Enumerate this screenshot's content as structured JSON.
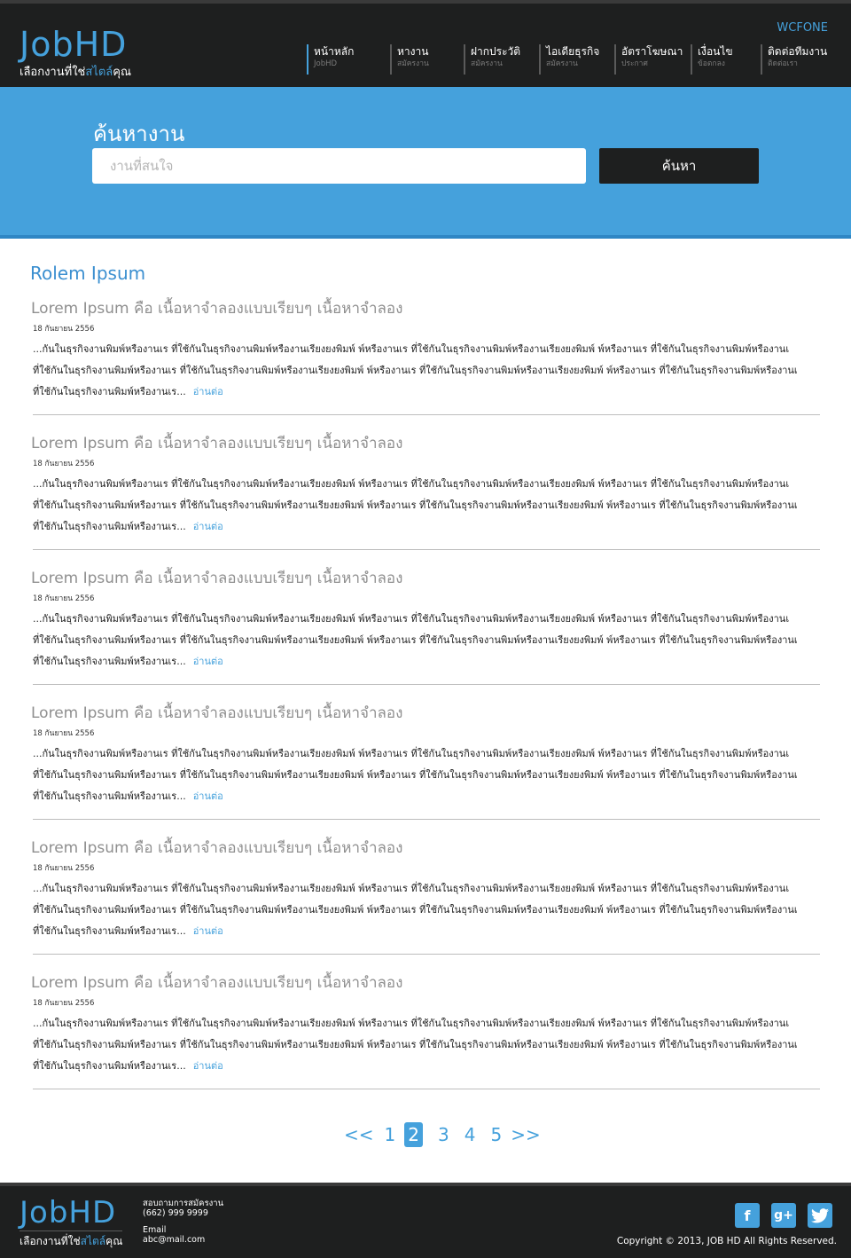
{
  "header": {
    "logo": "JobHD",
    "tagline_start": "เลือกงานที่ใช่",
    "tagline_highlight": "สไตล์",
    "tagline_end": "คุณ",
    "topright": "WCFONE"
  },
  "nav": [
    {
      "label": "หน้าหลัก",
      "sub": "JobHD"
    },
    {
      "label": "หางาน",
      "sub": "สมัครงาน"
    },
    {
      "label": "ฝากประวัติ",
      "sub": "สมัครงาน"
    },
    {
      "label": "ไอเดียธุรกิจ",
      "sub": "สมัครงาน"
    },
    {
      "label": "อัตราโฆษณา",
      "sub": "ประกาศ"
    },
    {
      "label": "เงื่อนไข",
      "sub": "ข้อตกลง"
    },
    {
      "label": "ติดต่อทีมงาน",
      "sub": "ติดต่อเรา"
    }
  ],
  "search": {
    "title": "ค้นหางาน",
    "placeholder": "งานที่สนใจ",
    "button": "ค้นหา"
  },
  "section": {
    "title": "Rolem Ipsum"
  },
  "articles": [
    {
      "title": "Lorem Ipsum คือ เนื้อหาจำลองแบบเรียบๆ เนื้อหาจำลอง",
      "date": "18 กันยายน 2556",
      "lines": [
        "...กันในธุรกิจงานพิมพ์หรืองานเร ที่ใช้กันในธุรกิจงานพิมพ์หรืองานเรียงยงพิมพ์ พ์หรืองานเร ที่ใช้กันในธุรกิจงานพิมพ์หรืองานเรียงยงพิมพ์ พ์หรืองานเร ที่ใช้กันในธุรกิจงานพิมพ์หรืองานเ",
        "ที่ใช้กันในธุรกิจงานพิมพ์หรืองานเร ที่ใช้กันในธุรกิจงานพิมพ์หรืองานเรียงยงพิมพ์ พ์หรืองานเร ที่ใช้กันในธุรกิจงานพิมพ์หรืองานเรียงยงพิมพ์ พ์หรืองานเร ที่ใช้กันในธุรกิจงานพิมพ์หรืองานเ",
        "ที่ใช้กันในธุรกิจงานพิมพ์หรืองานเร..."
      ],
      "readmore": "อ่านต่อ"
    },
    {
      "title": "Lorem Ipsum คือ เนื้อหาจำลองแบบเรียบๆ เนื้อหาจำลอง",
      "date": "18 กันยายน 2556",
      "lines": [
        "...กันในธุรกิจงานพิมพ์หรืองานเร ที่ใช้กันในธุรกิจงานพิมพ์หรืองานเรียงยงพิมพ์ พ์หรืองานเร ที่ใช้กันในธุรกิจงานพิมพ์หรืองานเรียงยงพิมพ์ พ์หรืองานเร ที่ใช้กันในธุรกิจงานพิมพ์หรืองานเ",
        "ที่ใช้กันในธุรกิจงานพิมพ์หรืองานเร ที่ใช้กันในธุรกิจงานพิมพ์หรืองานเรียงยงพิมพ์ พ์หรืองานเร ที่ใช้กันในธุรกิจงานพิมพ์หรืองานเรียงยงพิมพ์ พ์หรืองานเร ที่ใช้กันในธุรกิจงานพิมพ์หรืองานเ",
        "ที่ใช้กันในธุรกิจงานพิมพ์หรืองานเร..."
      ],
      "readmore": "อ่านต่อ"
    },
    {
      "title": "Lorem Ipsum คือ เนื้อหาจำลองแบบเรียบๆ เนื้อหาจำลอง",
      "date": "18 กันยายน 2556",
      "lines": [
        "...กันในธุรกิจงานพิมพ์หรืองานเร ที่ใช้กันในธุรกิจงานพิมพ์หรืองานเรียงยงพิมพ์ พ์หรืองานเร ที่ใช้กันในธุรกิจงานพิมพ์หรืองานเรียงยงพิมพ์ พ์หรืองานเร ที่ใช้กันในธุรกิจงานพิมพ์หรืองานเ",
        "ที่ใช้กันในธุรกิจงานพิมพ์หรืองานเร ที่ใช้กันในธุรกิจงานพิมพ์หรืองานเรียงยงพิมพ์ พ์หรืองานเร ที่ใช้กันในธุรกิจงานพิมพ์หรืองานเรียงยงพิมพ์ พ์หรืองานเร ที่ใช้กันในธุรกิจงานพิมพ์หรืองานเ",
        "ที่ใช้กันในธุรกิจงานพิมพ์หรืองานเร..."
      ],
      "readmore": "อ่านต่อ"
    },
    {
      "title": "Lorem Ipsum คือ เนื้อหาจำลองแบบเรียบๆ เนื้อหาจำลอง",
      "date": "18 กันยายน 2556",
      "lines": [
        "...กันในธุรกิจงานพิมพ์หรืองานเร ที่ใช้กันในธุรกิจงานพิมพ์หรืองานเรียงยงพิมพ์ พ์หรืองานเร ที่ใช้กันในธุรกิจงานพิมพ์หรืองานเรียงยงพิมพ์ พ์หรืองานเร ที่ใช้กันในธุรกิจงานพิมพ์หรืองานเ",
        "ที่ใช้กันในธุรกิจงานพิมพ์หรืองานเร ที่ใช้กันในธุรกิจงานพิมพ์หรืองานเรียงยงพิมพ์ พ์หรืองานเร ที่ใช้กันในธุรกิจงานพิมพ์หรืองานเรียงยงพิมพ์ พ์หรืองานเร ที่ใช้กันในธุรกิจงานพิมพ์หรืองานเ",
        "ที่ใช้กันในธุรกิจงานพิมพ์หรืองานเร..."
      ],
      "readmore": "อ่านต่อ"
    },
    {
      "title": "Lorem Ipsum คือ เนื้อหาจำลองแบบเรียบๆ เนื้อหาจำลอง",
      "date": "18 กันยายน 2556",
      "lines": [
        "...กันในธุรกิจงานพิมพ์หรืองานเร ที่ใช้กันในธุรกิจงานพิมพ์หรืองานเรียงยงพิมพ์ พ์หรืองานเร ที่ใช้กันในธุรกิจงานพิมพ์หรืองานเรียงยงพิมพ์ พ์หรืองานเร ที่ใช้กันในธุรกิจงานพิมพ์หรืองานเ",
        "ที่ใช้กันในธุรกิจงานพิมพ์หรืองานเร ที่ใช้กันในธุรกิจงานพิมพ์หรืองานเรียงยงพิมพ์ พ์หรืองานเร ที่ใช้กันในธุรกิจงานพิมพ์หรืองานเรียงยงพิมพ์ พ์หรืองานเร ที่ใช้กันในธุรกิจงานพิมพ์หรืองานเ",
        "ที่ใช้กันในธุรกิจงานพิมพ์หรืองานเร..."
      ],
      "readmore": "อ่านต่อ"
    },
    {
      "title": "Lorem Ipsum คือ เนื้อหาจำลองแบบเรียบๆ เนื้อหาจำลอง",
      "date": "18 กันยายน 2556",
      "lines": [
        "...กันในธุรกิจงานพิมพ์หรืองานเร ที่ใช้กันในธุรกิจงานพิมพ์หรืองานเรียงยงพิมพ์ พ์หรืองานเร ที่ใช้กันในธุรกิจงานพิมพ์หรืองานเรียงยงพิมพ์ พ์หรืองานเร ที่ใช้กันในธุรกิจงานพิมพ์หรืองานเ",
        "ที่ใช้กันในธุรกิจงานพิมพ์หรืองานเร ที่ใช้กันในธุรกิจงานพิมพ์หรืองานเรียงยงพิมพ์ พ์หรืองานเร ที่ใช้กันในธุรกิจงานพิมพ์หรืองานเรียงยงพิมพ์ พ์หรืองานเร ที่ใช้กันในธุรกิจงานพิมพ์หรืองานเ",
        "ที่ใช้กันในธุรกิจงานพิมพ์หรืองานเร..."
      ],
      "readmore": "อ่านต่อ"
    }
  ],
  "pagination": {
    "prev": "<<",
    "pages": [
      "1",
      "2",
      "3",
      "4",
      "5"
    ],
    "current": "2",
    "next": ">>"
  },
  "footer": {
    "contact_title": "สอบถามการสมัครงาน",
    "phone": "(662) 999 9999",
    "email_label": "Email",
    "email": "abc@mail.com",
    "socials": [
      {
        "name": "facebook-icon",
        "glyph": "f"
      },
      {
        "name": "google-plus-icon",
        "glyph": "g+"
      },
      {
        "name": "twitter-icon",
        "glyph": "t"
      }
    ],
    "copyright": "Copyright © 2013, JOB HD All Rights Reserved."
  },
  "colors": {
    "accent": "#45a1dc",
    "dark": "#1e1f1f",
    "title_grey": "#8f8f8f"
  }
}
